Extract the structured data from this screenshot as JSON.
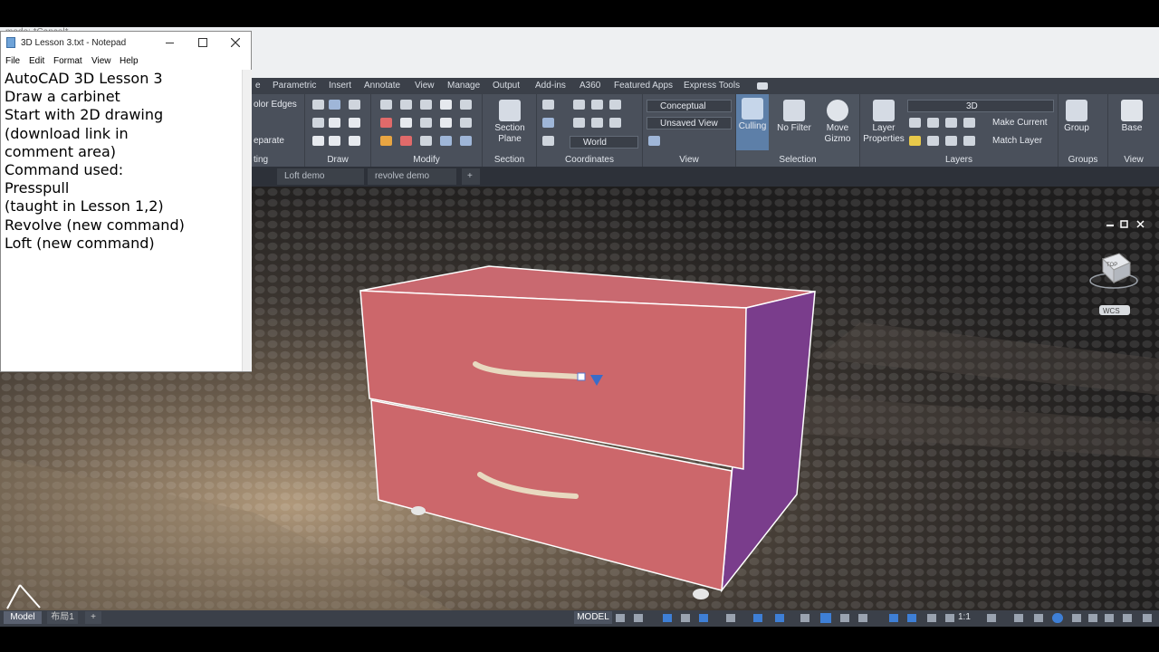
{
  "acad": {
    "title_text": "mode: *Cancel*",
    "ribbon_tabs": [
      "Parametric",
      "Insert",
      "Annotate",
      "View",
      "Manage",
      "Output",
      "Add-ins",
      "A360",
      "Featured Apps",
      "Express Tools"
    ],
    "panels": {
      "modeling_partial": {
        "color_edges": "olor Edges",
        "separate": "eparate",
        "footer": "ting"
      },
      "draw": "Draw",
      "modify": "Modify",
      "section": {
        "label": "Section",
        "button": "Section\nPlane"
      },
      "coordinates": {
        "label": "Coordinates",
        "ucs_value": "World"
      },
      "view": {
        "label": "View",
        "visual_style": "Conceptual",
        "named_view": "Unsaved View"
      },
      "selection": {
        "label": "Selection",
        "culling": "Culling",
        "no_filter": "No Filter",
        "move_gizmo": "Move\nGizmo"
      },
      "layers": {
        "label": "Layers",
        "layer_properties": "Layer\nProperties",
        "current_layer": "3D",
        "make_current": "Make Current",
        "match_layer": "Match Layer"
      },
      "groups": {
        "label": "Groups",
        "group": "Group"
      },
      "view2": {
        "label": "View",
        "base": "Base"
      }
    },
    "doc_tabs": [
      "Loft demo",
      "revolve demo"
    ],
    "viewcube": {
      "top_label": "TOP",
      "wcs": "WCS"
    },
    "status": {
      "model_button": "MODEL",
      "scale": "1:1",
      "model_tab": "Model",
      "layout_tab": "布局1"
    }
  },
  "notepad": {
    "title": "3D Lesson 3.txt - Notepad",
    "menu": [
      "File",
      "Edit",
      "Format",
      "View",
      "Help"
    ],
    "lines": [
      "AutoCAD 3D Lesson 3",
      "",
      "Draw a carbinet",
      "",
      "Start with 2D drawing",
      "(download link in",
      "comment area)",
      "",
      "Command used:",
      "Presspull",
      "(taught in Lesson 1,2)",
      "Revolve (new command)",
      "Loft (new command)"
    ]
  },
  "colors": {
    "cabinet_front": "#c9676c",
    "cabinet_side": "#7b3c8a",
    "ribbon": "#4a505b"
  }
}
